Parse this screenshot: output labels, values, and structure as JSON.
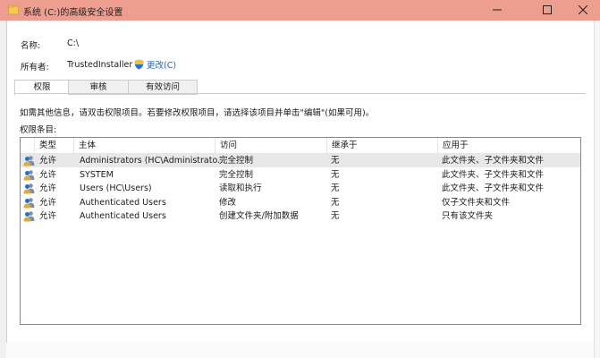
{
  "window": {
    "title": "系统 (C:)的高级安全设置",
    "min_label": "—",
    "max_label": "☐",
    "close_label": "✕"
  },
  "properties": {
    "name_label": "名称:",
    "name_value": "C:\\",
    "owner_label": "所有者:",
    "owner_value": "TrustedInstaller",
    "change_link": "更改(C)"
  },
  "tabs": [
    {
      "label": "权限",
      "active": true
    },
    {
      "label": "审核",
      "active": false
    },
    {
      "label": "有效访问",
      "active": false
    }
  ],
  "info_text": "如需其他信息，请双击权限项目。若要修改权限项目，请选择该项目并单击\"编辑\"(如果可用)。",
  "entries_label": "权限条目:",
  "table": {
    "columns": [
      "类型",
      "主体",
      "访问",
      "继承于",
      "应用于"
    ],
    "rows": [
      {
        "type": "允许",
        "principal": "Administrators (HC\\Administrato...",
        "access": "完全控制",
        "inherited": "无",
        "applies": "此文件夹、子文件夹和文件",
        "selected": true
      },
      {
        "type": "允许",
        "principal": "SYSTEM",
        "access": "完全控制",
        "inherited": "无",
        "applies": "此文件夹、子文件夹和文件",
        "selected": false
      },
      {
        "type": "允许",
        "principal": "Users (HC\\Users)",
        "access": "读取和执行",
        "inherited": "无",
        "applies": "此文件夹、子文件夹和文件",
        "selected": false
      },
      {
        "type": "允许",
        "principal": "Authenticated Users",
        "access": "修改",
        "inherited": "无",
        "applies": "仅子文件夹和文件",
        "selected": false
      },
      {
        "type": "允许",
        "principal": "Authenticated Users",
        "access": "创建文件夹/附加数据",
        "inherited": "无",
        "applies": "只有该文件夹",
        "selected": false
      }
    ]
  },
  "colors": {
    "titlebar": "#ee9e8f",
    "link": "#1a66c6",
    "selected_row": "#e8e8e8"
  }
}
